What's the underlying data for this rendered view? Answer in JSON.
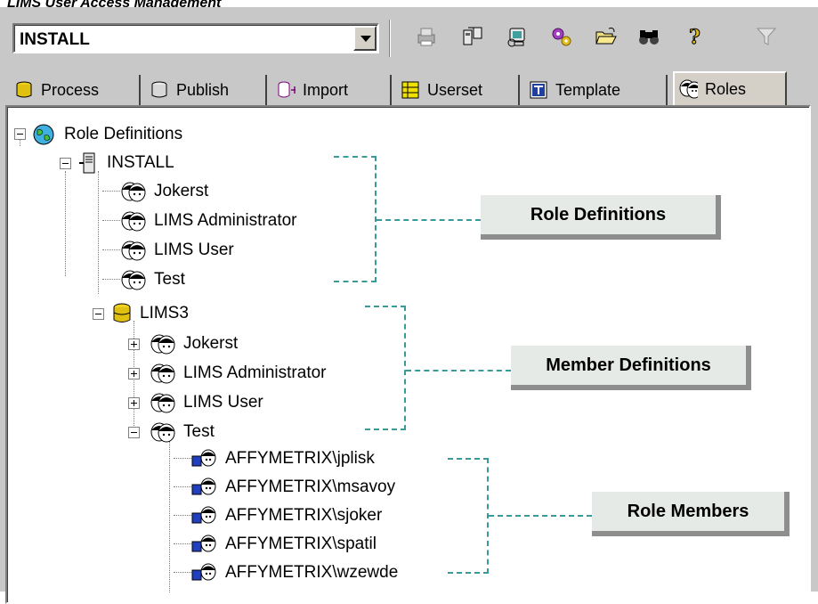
{
  "page_title": "LIMS User Access Management",
  "toolbar": {
    "project_select": "INSTALL",
    "icons": [
      "print-icon",
      "export-icon",
      "refresh-icon",
      "settings-icon",
      "open-folder-icon",
      "find-icon",
      "help-icon",
      "filter-icon"
    ]
  },
  "tabs": [
    {
      "label": "Process",
      "icon": "database-icon"
    },
    {
      "label": "Publish",
      "icon": "publish-icon"
    },
    {
      "label": "Import",
      "icon": "import-icon"
    },
    {
      "label": "Userset",
      "icon": "userset-icon"
    },
    {
      "label": "Template",
      "icon": "template-icon"
    },
    {
      "label": "Roles",
      "icon": "roles-icon",
      "active": true
    }
  ],
  "tree": {
    "root": "Role Definitions",
    "install": {
      "label": "INSTALL",
      "roles": [
        "Jokerst",
        "LIMS Administrator",
        "LIMS User",
        "Test"
      ]
    },
    "lims3": {
      "label": "LIMS3",
      "roles": [
        "Jokerst",
        "LIMS Administrator",
        "LIMS User",
        "Test"
      ],
      "members": [
        "AFFYMETRIX\\jplisk",
        "AFFYMETRIX\\msavoy",
        "AFFYMETRIX\\sjoker",
        "AFFYMETRIX\\spatil",
        "AFFYMETRIX\\wzewde"
      ]
    }
  },
  "callouts": {
    "role_definitions": "Role Definitions",
    "member_definitions": "Member Definitions",
    "role_members": "Role Members"
  },
  "colors": {
    "callout_bg": "#e6eae6",
    "callout_line": "#3a9a9a",
    "window_bg": "#c8c8c8"
  }
}
